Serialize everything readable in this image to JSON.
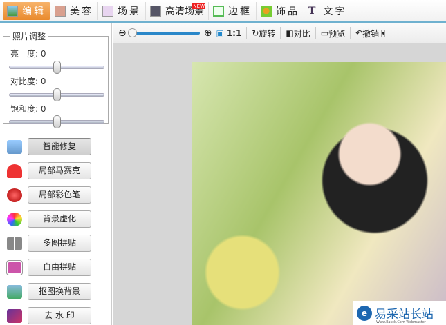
{
  "tabs": [
    {
      "label": "编辑",
      "icon": "landscape-icon"
    },
    {
      "label": "美容",
      "icon": "face-icon"
    },
    {
      "label": "场景",
      "icon": "scene-icon"
    },
    {
      "label": "高清场景",
      "icon": "hd-scene-icon",
      "badge": "NEW"
    },
    {
      "label": "边框",
      "icon": "frame-icon"
    },
    {
      "label": "饰品",
      "icon": "clover-icon"
    },
    {
      "label": "文字",
      "icon": "text-icon",
      "glyph": "T"
    }
  ],
  "adjust": {
    "title": "照片调整",
    "brightness": "亮　度: 0",
    "contrast": "对比度: 0",
    "saturation": "饱和度: 0",
    "values": {
      "brightness": 0,
      "contrast": 0,
      "saturation": 0
    }
  },
  "tools": [
    "智能修复",
    "局部马赛克",
    "局部彩色笔",
    "背景虚化",
    "多图拼贴",
    "自由拼贴",
    "抠图换背景",
    "去 水 印"
  ],
  "toolbar": {
    "ratio": "1:1",
    "rotate": "旋转",
    "compare": "对比",
    "preview": "预览",
    "undo": "撤销"
  },
  "watermark": {
    "icon": "e",
    "title": "易采站长站",
    "subtitle": "Www.Easck.Com Webmaster"
  }
}
